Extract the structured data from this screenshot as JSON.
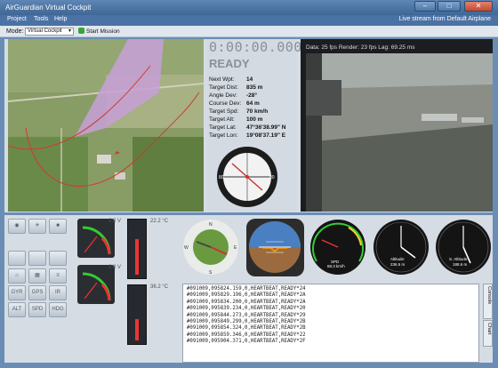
{
  "window": {
    "title": "AirGuardian Virtual Cockpit",
    "minimize": "–",
    "maximize": "□",
    "close": "✕"
  },
  "menu": {
    "items": [
      "Project",
      "Tools",
      "Help"
    ],
    "live_stream": "Live stream from Default Airplane"
  },
  "toolbar": {
    "mode_label": "Mode:",
    "mode_value": "Virtual Cockpit",
    "start_mission": "Start Mission"
  },
  "flight": {
    "timer": "0:00:00.000",
    "status": "READY",
    "rows": [
      {
        "key": "Next Wpt:",
        "val": "14"
      },
      {
        "key": "Target Dist:",
        "val": "835 m"
      },
      {
        "key": "Angle Dev:",
        "val": "-28°"
      },
      {
        "key": "Course Dev:",
        "val": "64 m"
      },
      {
        "key": "Target Spd:",
        "val": "70 km/h"
      },
      {
        "key": "Target Alt:",
        "val": "100 m"
      },
      {
        "key": "Target Lat:",
        "val": "47°36'38.99\" N"
      },
      {
        "key": "Target Lon:",
        "val": "19°08'37.19\" E"
      }
    ]
  },
  "video": {
    "stats": "Data: 25 fps   Render: 23 fps   Lag: 69.25 ms"
  },
  "sidebar": {
    "row3": [
      "GYR",
      "GPS",
      "IR"
    ],
    "row4": [
      "ALT",
      "SPD",
      "HDG"
    ]
  },
  "gauges": {
    "v1": "0.0 V",
    "v2": "0.0 V",
    "t1": "22.2 °C",
    "t2": "36.2 °C",
    "speed_label": "SPD",
    "speed_value": "68.3 km/h",
    "alt_label": "Altitude:",
    "alt_value": "236.5 m",
    "s_alt_label": "S. Altitude:",
    "s_alt_value": "188.6 m",
    "ticks": [
      "80",
      "40",
      "20",
      "0"
    ],
    "compass": [
      "N",
      "30",
      "60",
      "E",
      "120",
      "150",
      "S",
      "210",
      "240",
      "W",
      "300",
      "330"
    ]
  },
  "log": {
    "lines": [
      "#091009,095824.159,0,HEARTBEAT,READY*24",
      "#091009,095829.196,0,HEARTBEAT,READY*2A",
      "#091009,095834.200,0,HEARTBEAT,READY*2A",
      "#091009,095839.234,0,HEARTBEAT,READY*20",
      "#091009,095844.273,0,HEARTBEAT,READY*29",
      "#091009,095849.299,0,HEARTBEAT,READY*2B",
      "#091009,095854.324,0,HEARTBEAT,READY*2B",
      "#091009,095859.346,0,HEARTBEAT,READY*22",
      "#091009,095904.371,0,HEARTBEAT,READY*2F"
    ]
  },
  "tabs": {
    "console": "Console",
    "chart": "Chart"
  },
  "colors": {
    "accent": "#4a72a4",
    "map_zone": "#c7a0d8",
    "track": "#d23a2a"
  }
}
